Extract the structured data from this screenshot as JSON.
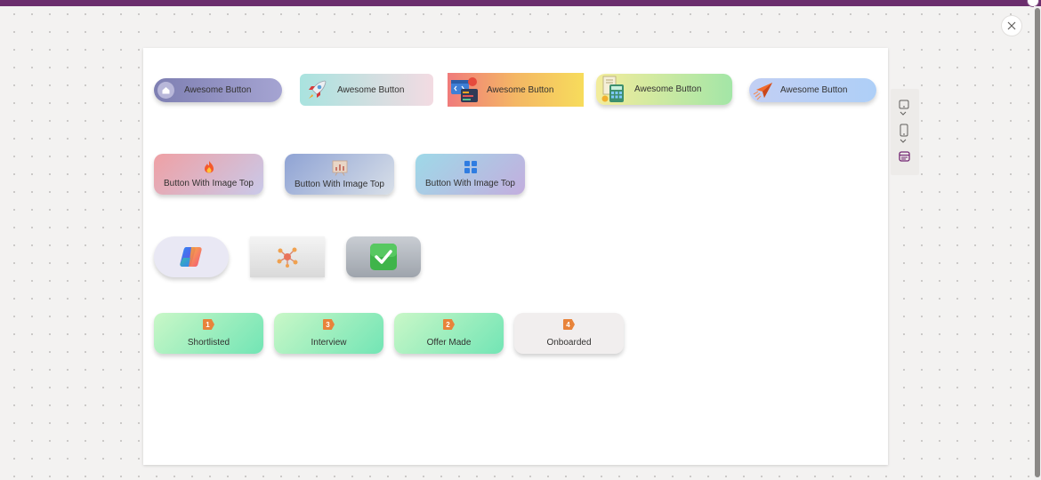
{
  "row1": {
    "buttons": [
      {
        "label": "Awesome Button",
        "icon": "home-icon"
      },
      {
        "label": "Awesome Button",
        "icon": "rocket-icon"
      },
      {
        "label": "Awesome Button",
        "icon": "code-window-icon"
      },
      {
        "label": "Awesome Button",
        "icon": "calculator-icon"
      },
      {
        "label": "Awesome Button",
        "icon": "paper-plane-icon"
      }
    ]
  },
  "row2": {
    "buttons": [
      {
        "label": "Button With Image Top",
        "icon": "fire-icon"
      },
      {
        "label": "Button With Image Top",
        "icon": "chart-icon"
      },
      {
        "label": "Button With Image Top",
        "icon": "grid-icon"
      }
    ]
  },
  "row3": {
    "buttons": [
      {
        "icon": "copilot-icon"
      },
      {
        "icon": "network-icon"
      },
      {
        "icon": "checkmark-icon"
      }
    ]
  },
  "row4": {
    "stages": [
      {
        "number": "1",
        "label": "Shortlisted"
      },
      {
        "number": "3",
        "label": "Interview"
      },
      {
        "number": "2",
        "label": "Offer Made"
      },
      {
        "number": "4",
        "label": "Onboarded"
      }
    ]
  },
  "side_panel": {
    "icons": [
      "tablet-icon",
      "phone-icon",
      "browser-icon"
    ]
  },
  "colors": {
    "topbar": "#6b2e6d",
    "accent": "#742774",
    "stage_badge": "#e8833a",
    "canvas": "#ffffff"
  }
}
